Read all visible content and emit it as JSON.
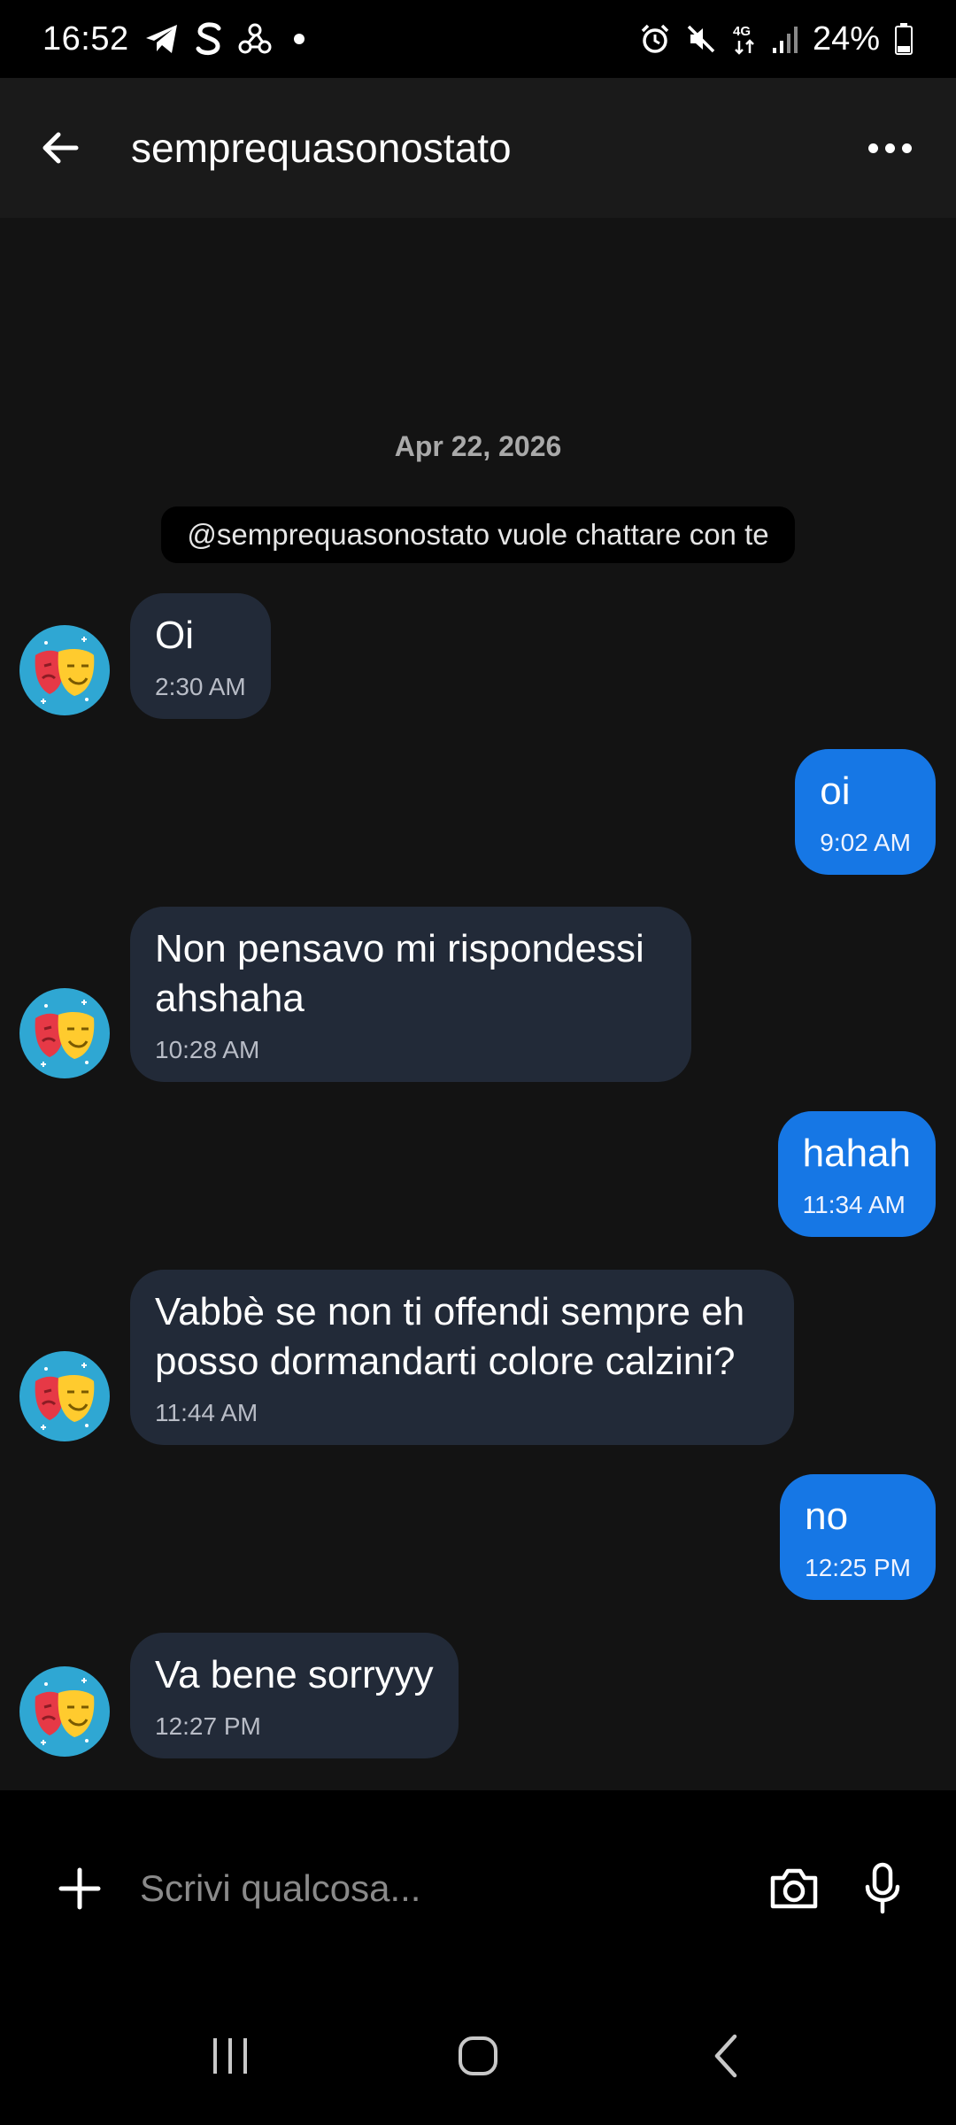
{
  "status_bar": {
    "time": "16:52",
    "left_icons": [
      "telegram-icon",
      "skype-icon",
      "webhook-icon",
      "notification-dot"
    ],
    "right_icons": [
      "alarm-icon",
      "mute-icon",
      "network-4g-icon",
      "signal-icon",
      "battery-icon"
    ],
    "battery": "24%"
  },
  "header": {
    "title": "semprequasonostato",
    "back_icon": "arrow-left-icon",
    "menu_icon": "more-horizontal-icon"
  },
  "chat": {
    "date": "Apr 22, 2026",
    "system_message": "@semprequasonostato vuole chattare con te",
    "messages": [
      {
        "direction": "in",
        "text": "Oi",
        "time": "2:30 AM"
      },
      {
        "direction": "out",
        "text": "oi",
        "time": "9:02 AM"
      },
      {
        "direction": "in",
        "text": "Non pensavo mi rispondessi ahshaha",
        "time": "10:28 AM"
      },
      {
        "direction": "out",
        "text": "hahah",
        "time": "11:34 AM"
      },
      {
        "direction": "in",
        "text": "Vabbè se non ti offendi sempre eh posso dormandarti colore calzini?",
        "time": "11:44 AM"
      },
      {
        "direction": "out",
        "text": "no",
        "time": "12:25 PM"
      },
      {
        "direction": "in",
        "text": "Va bene sorryyy",
        "time": "12:27 PM"
      }
    ]
  },
  "input_bar": {
    "placeholder": "Scrivi qualcosa...",
    "icons": [
      "plus-icon",
      "camera-icon",
      "microphone-icon"
    ]
  },
  "nav_bar": {
    "icons": [
      "recent-apps-icon",
      "home-icon",
      "back-icon"
    ]
  },
  "colors": {
    "incoming_bubble": "#222a38",
    "outgoing_bubble": "#1677e5",
    "chat_background": "#131313",
    "header_background": "#1a1a1a"
  }
}
